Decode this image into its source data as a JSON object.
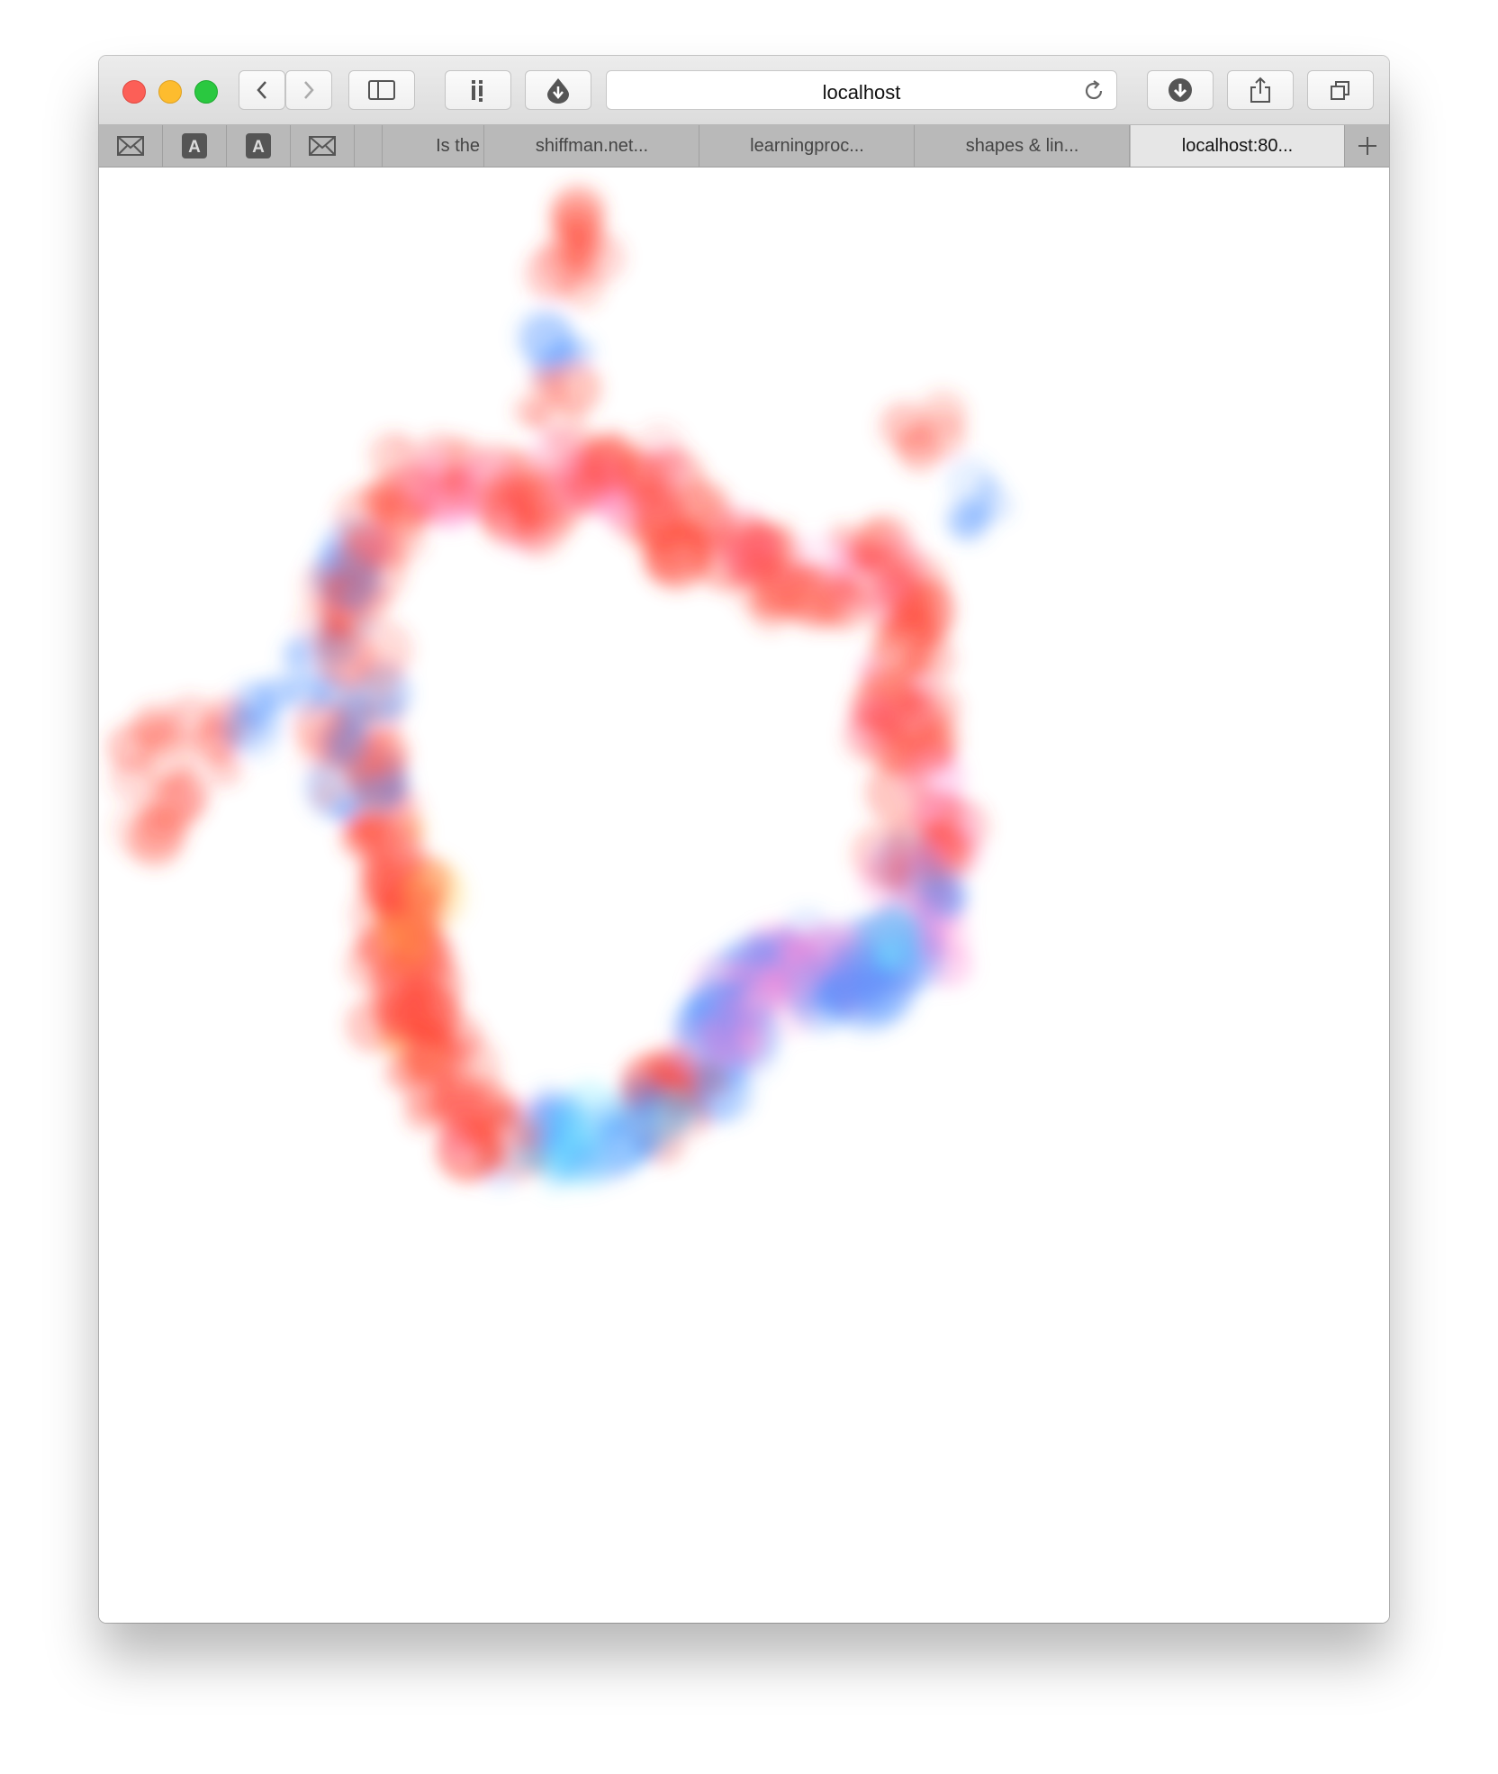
{
  "toolbar": {
    "address": "localhost",
    "buttons": [
      "back-icon",
      "forward-icon",
      "sidebar-icon",
      "instapaper-icon",
      "download-extension-icon",
      "downloads-icon",
      "share-icon",
      "tabs-overview-icon"
    ]
  },
  "tabs": {
    "pinned": [
      "mail-icon",
      "a-icon",
      "a-icon",
      "mail-icon"
    ],
    "items": [
      {
        "label": "Is the",
        "active": false
      },
      {
        "label": "shiffman.net...",
        "active": false
      },
      {
        "label": "learningproc...",
        "active": false
      },
      {
        "label": "shapes & lin...",
        "active": false
      },
      {
        "label": "localhost:80...",
        "active": true
      }
    ]
  },
  "canvas": {
    "palette": {
      "red": "#ff4a3a",
      "blue": "#4a90ff",
      "pink": "#ff8ad8",
      "yellow": "#ffd24a",
      "cyan": "#6ae8ff"
    }
  }
}
